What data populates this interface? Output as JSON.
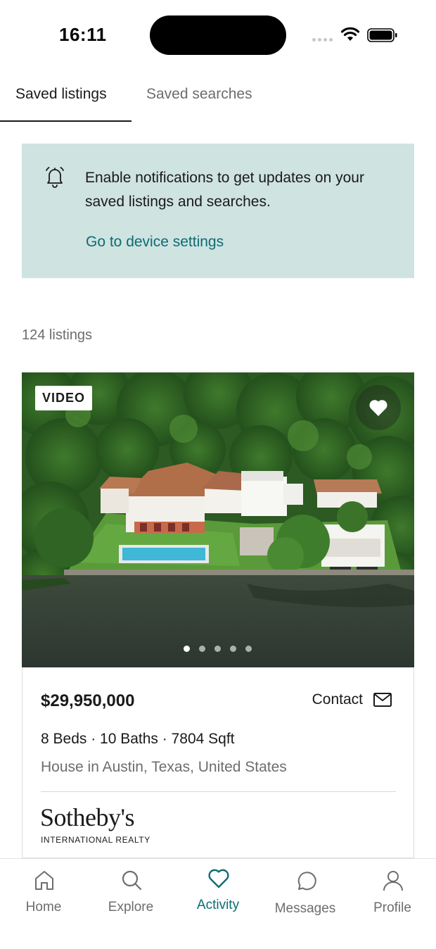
{
  "status_bar": {
    "time": "16:11"
  },
  "tabs": [
    {
      "label": "Saved listings",
      "active": true
    },
    {
      "label": "Saved searches",
      "active": false
    }
  ],
  "notification": {
    "icon": "bell-icon",
    "message": "Enable notifications to get updates on your saved listings and searches.",
    "link": "Go to device settings"
  },
  "listing_count": "124 listings",
  "listing": {
    "badge": "VIDEO",
    "favorited": true,
    "photo_dots": 5,
    "active_photo": 1,
    "price": "$29,950,000",
    "contact_label": "Contact",
    "specs": "8 Beds · 10 Baths · 7804 Sqft",
    "location": "House in Austin, Texas, United States",
    "brand": {
      "name": "Sotheby's",
      "subtitle": "INTERNATIONAL REALTY"
    }
  },
  "bottom_nav": [
    {
      "label": "Home",
      "icon": "home-icon",
      "active": false
    },
    {
      "label": "Explore",
      "icon": "search-icon",
      "active": false
    },
    {
      "label": "Activity",
      "icon": "heart-icon",
      "active": true
    },
    {
      "label": "Messages",
      "icon": "chat-bubble-icon",
      "active": false
    },
    {
      "label": "Profile",
      "icon": "person-icon",
      "active": false
    }
  ],
  "colors": {
    "accent": "#0c6c72",
    "banner_bg": "#cfe3e1",
    "muted_text": "#6d6d6d"
  }
}
